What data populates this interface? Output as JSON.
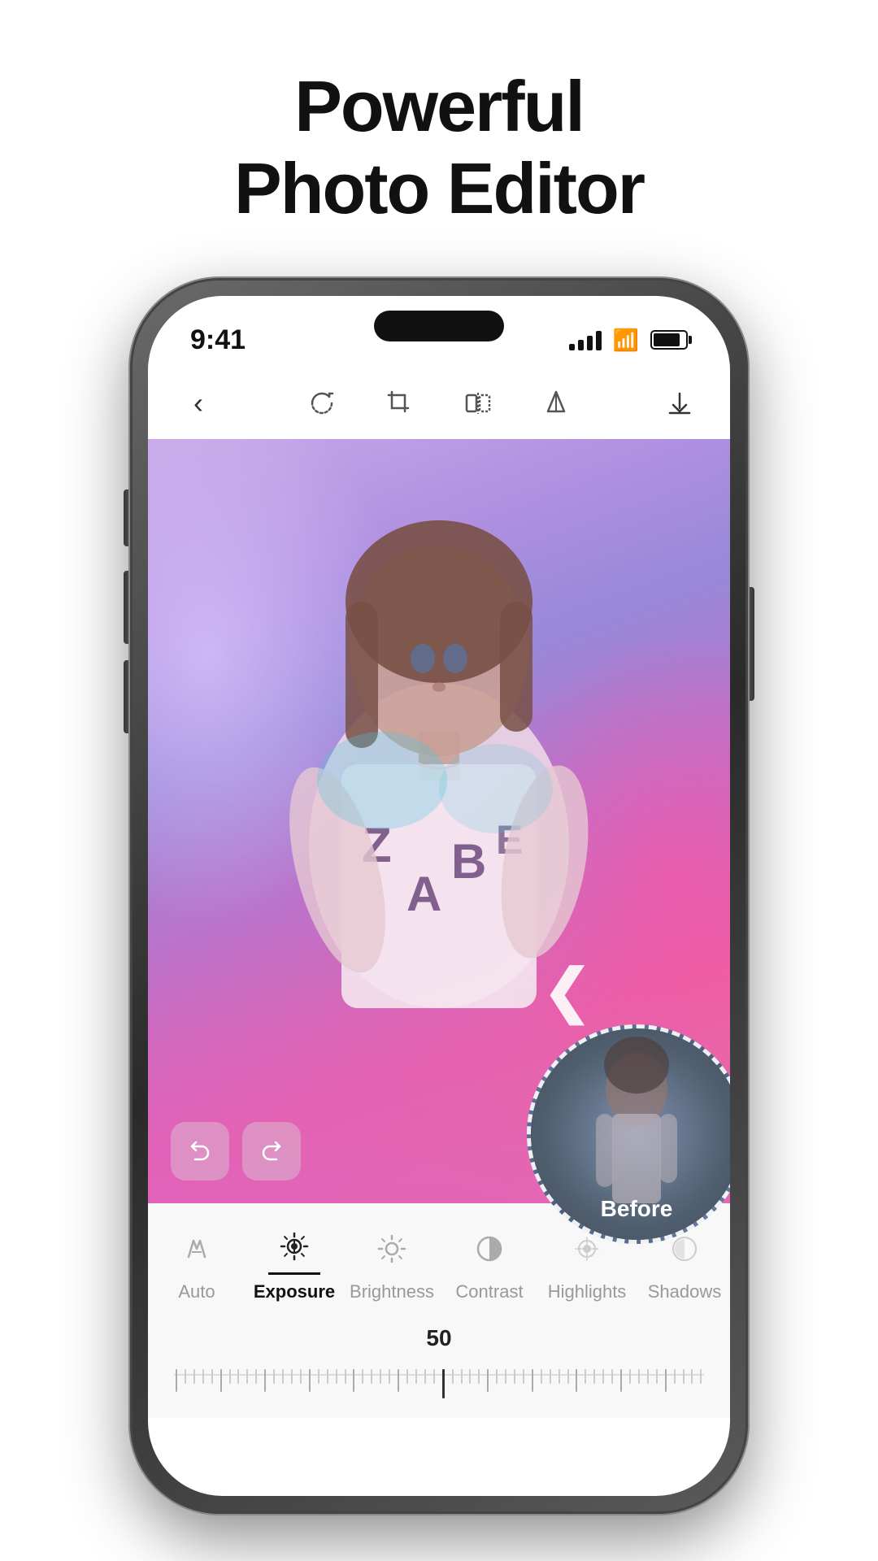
{
  "headline": {
    "line1": "Powerful",
    "line2": "Photo Editor"
  },
  "status_bar": {
    "time": "9:41",
    "signal": "signal",
    "wifi": "wifi",
    "battery": "battery"
  },
  "toolbar": {
    "back_label": "back",
    "rotate_label": "rotate",
    "crop_label": "crop",
    "flip_label": "flip",
    "adjust_label": "adjust",
    "download_label": "download"
  },
  "undo_redo": {
    "undo_label": "undo",
    "redo_label": "redo"
  },
  "before_label": "Before",
  "tool_tabs": [
    {
      "id": "auto",
      "label": "Auto",
      "active": false
    },
    {
      "id": "exposure",
      "label": "Exposure",
      "active": true
    },
    {
      "id": "brightness",
      "label": "Brightness",
      "active": false
    },
    {
      "id": "contrast",
      "label": "Contrast",
      "active": false
    },
    {
      "id": "highlights",
      "label": "Highlights",
      "active": false
    },
    {
      "id": "shadows",
      "label": "Shadows",
      "active": false
    }
  ],
  "slider": {
    "value": "50"
  }
}
